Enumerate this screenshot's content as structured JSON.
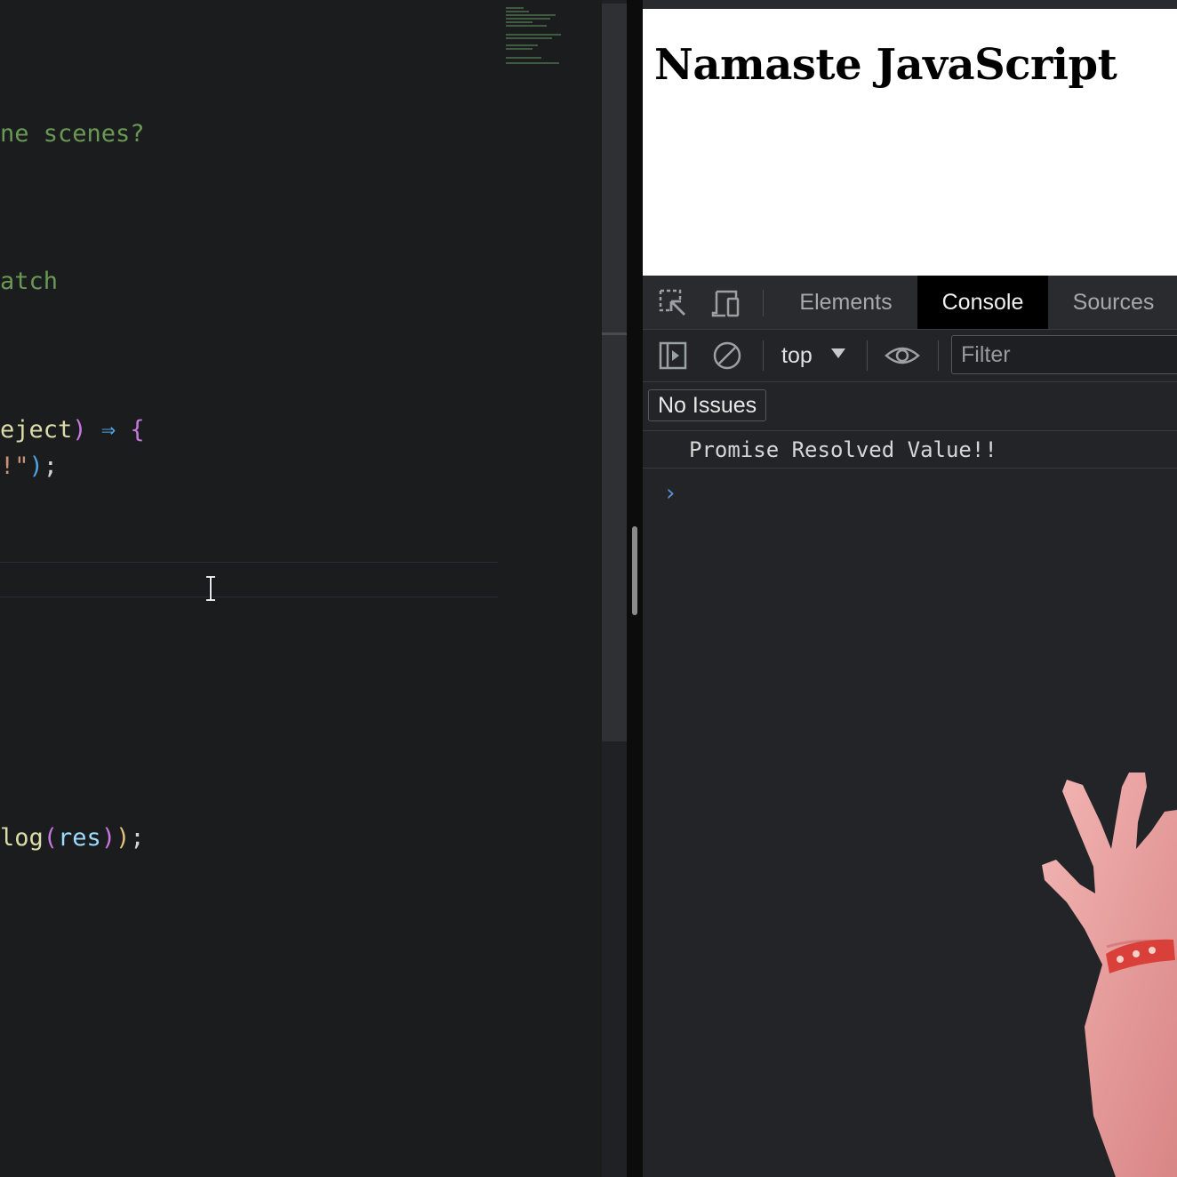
{
  "editor": {
    "lines": [
      {
        "id": "l1",
        "segments": [
          {
            "cls": "c-comment",
            "text": "ne scenes?"
          }
        ]
      },
      {
        "id": "l2",
        "segments": [
          {
            "cls": "c-comment",
            "text": "atch"
          }
        ]
      },
      {
        "id": "l3",
        "segments": [
          {
            "cls": "c-fn",
            "text": "eject"
          },
          {
            "cls": "c-paren-p",
            "text": ")"
          },
          {
            "cls": "c-text",
            "text": " "
          },
          {
            "cls": "c-arrow",
            "text": "⇒"
          },
          {
            "cls": "c-text",
            "text": " "
          },
          {
            "cls": "c-paren-p",
            "text": "{"
          }
        ]
      },
      {
        "id": "l4",
        "segments": [
          {
            "cls": "c-string",
            "text": "!\""
          },
          {
            "cls": "c-paren-b",
            "text": ")"
          },
          {
            "cls": "c-semi",
            "text": ";"
          }
        ]
      },
      {
        "id": "l5",
        "segments": [
          {
            "cls": "c-fn",
            "text": "log"
          },
          {
            "cls": "c-paren-p",
            "text": "("
          },
          {
            "cls": "c-var",
            "text": "res"
          },
          {
            "cls": "c-paren-p",
            "text": ")"
          },
          {
            "cls": "c-paren-y",
            "text": ")"
          },
          {
            "cls": "c-semi",
            "text": ";"
          }
        ]
      }
    ]
  },
  "page": {
    "heading": "Namaste JavaScript"
  },
  "devtools": {
    "tabs": [
      {
        "label": "Elements",
        "active": false
      },
      {
        "label": "Console",
        "active": true
      },
      {
        "label": "Sources",
        "active": false
      }
    ],
    "context": "top",
    "filter_placeholder": "Filter",
    "issues_label": "No Issues",
    "console_messages": [
      "Promise Resolved Value!!"
    ],
    "prompt_symbol": "›",
    "icons": {
      "inspect": "inspect-element-icon",
      "device": "device-toolbar-icon",
      "sidebar": "show-sidebar-icon",
      "clear": "clear-console-icon",
      "eye": "live-expression-icon"
    }
  }
}
